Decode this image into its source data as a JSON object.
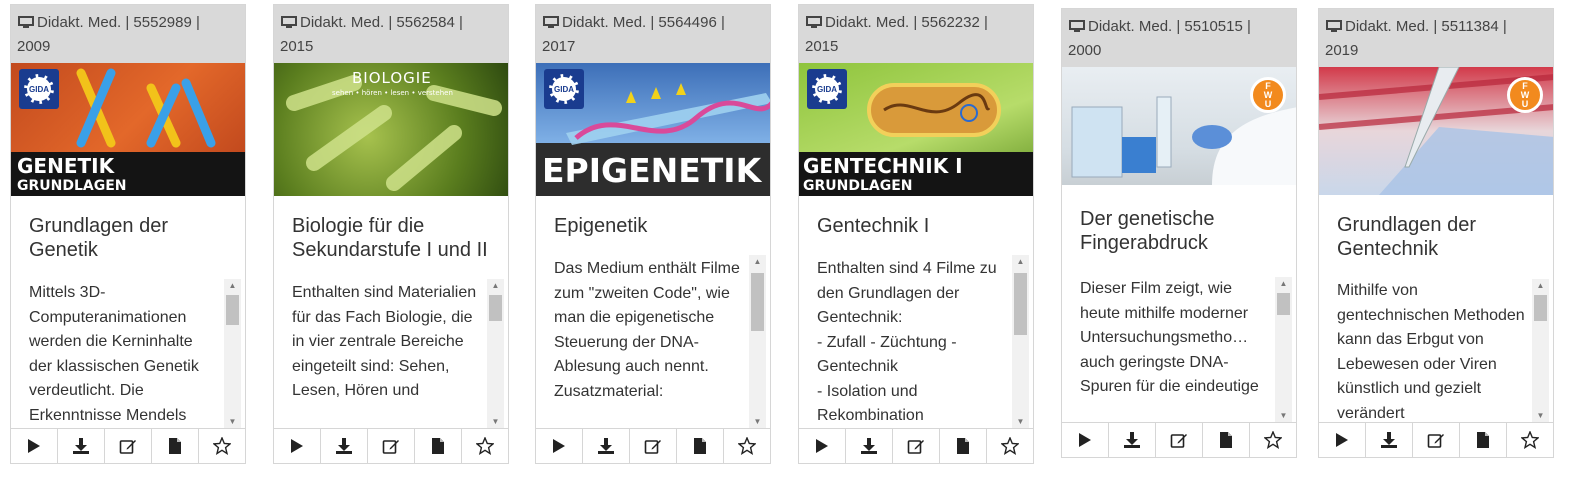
{
  "cards": [
    {
      "meta_line1": "Didakt. Med. | 5552989 |",
      "meta_line2": "2009",
      "title": "Grundlagen der Genetik",
      "description": "Mittels 3D-Computeranimationen werden die Kerninhalte der klassischen Genetik verdeutlicht. Die Erkenntnisse Mendels",
      "overlay_line1": "GENETIK",
      "overlay_line2": "GRUNDLAGEN",
      "logo": "GIDA"
    },
    {
      "meta_line1": "Didakt. Med. | 5562584 |",
      "meta_line2": "2015",
      "title": "Biologie für die Sekundarstufe I und II",
      "description": "Enthalten sind Materialien für das Fach Biologie, die in vier zentrale Bereiche eingeteilt sind: Sehen, Lesen, Hören und",
      "overlay_line1": "BIOLOGIE",
      "overlay_line2": "sehen • hören • lesen • verstehen",
      "logo": ""
    },
    {
      "meta_line1": "Didakt. Med. | 5564496 |",
      "meta_line2": "2017",
      "title": "Epigenetik",
      "description": "Das Medium enthält Filme zum \"zweiten Code\", wie man die epigenetische Steuerung der DNA-Ablesung auch nennt. Zusatzmaterial:",
      "overlay_line1": "EPIGENETIK",
      "overlay_line2": "",
      "logo": "GIDA"
    },
    {
      "meta_line1": "Didakt. Med. | 5562232 |",
      "meta_line2": "2015",
      "title": "Gentechnik I",
      "description": "Enthalten sind 4 Filme zu den Grundlagen der Gentechnik:\n- Zufall - Züchtung - Gentechnik\n- Isolation und Rekombination",
      "overlay_line1": "GENTECHNIK I",
      "overlay_line2": "GRUNDLAGEN",
      "logo": "GIDA"
    },
    {
      "meta_line1": "Didakt. Med. | 5510515 |",
      "meta_line2": "2000",
      "title": "Der genetische Fingerabdruck",
      "description": "Dieser Film zeigt, wie heute mithilfe moderner Untersuchungsmetho… auch geringste DNA-Spuren für die eindeutige",
      "overlay_line1": "",
      "overlay_line2": "",
      "logo": "FWU"
    },
    {
      "meta_line1": "Didakt. Med. | 5511384 |",
      "meta_line2": "2019",
      "title": "Grundlagen der Gentechnik",
      "description": "Mithilfe von gentechnischen Methoden kann das Erbgut von Lebewesen oder Viren künstlich und gezielt verändert",
      "overlay_line1": "",
      "overlay_line2": "",
      "logo": "FWU"
    }
  ],
  "icons": {
    "monitor": "monitor-icon",
    "play": "play-icon",
    "download": "download-icon",
    "edit": "edit-icon",
    "document": "document-icon",
    "star": "star-icon"
  }
}
